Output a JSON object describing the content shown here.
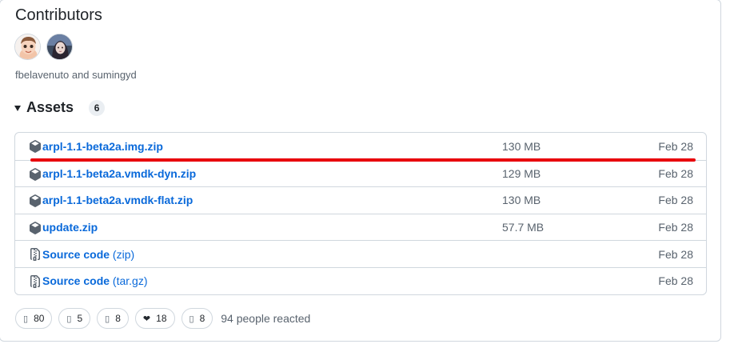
{
  "contributors": {
    "title": "Contributors",
    "names": "fbelavenuto and sumingyd",
    "avatars": [
      {
        "name": "fbelavenuto"
      },
      {
        "name": "sumingyd"
      }
    ]
  },
  "assets": {
    "title": "Assets",
    "count": "6",
    "items": [
      {
        "icon": "package-icon",
        "name": "arpl-1.1-beta2a.img.zip",
        "size": "130 MB",
        "date": "Feb 28"
      },
      {
        "icon": "package-icon",
        "name": "arpl-1.1-beta2a.vmdk-dyn.zip",
        "size": "129 MB",
        "date": "Feb 28"
      },
      {
        "icon": "package-icon",
        "name": "arpl-1.1-beta2a.vmdk-flat.zip",
        "size": "130 MB",
        "date": "Feb 28"
      },
      {
        "icon": "package-icon",
        "name": "update.zip",
        "size": "57.7 MB",
        "date": "Feb 28"
      },
      {
        "icon": "file-zip-icon",
        "name": "Source code",
        "ext": "(zip)",
        "size": "",
        "date": "Feb 28"
      },
      {
        "icon": "file-zip-icon",
        "name": "Source code",
        "ext": "(tar.gz)",
        "size": "",
        "date": "Feb 28"
      }
    ]
  },
  "reactions": {
    "items": [
      {
        "icon": "emoji-placeholder-icon",
        "glyph": "▯",
        "count": "80"
      },
      {
        "icon": "emoji-placeholder-icon",
        "glyph": "▯",
        "count": "5"
      },
      {
        "icon": "emoji-placeholder-icon",
        "glyph": "▯",
        "count": "8"
      },
      {
        "icon": "heart-icon",
        "glyph": "❤",
        "count": "18"
      },
      {
        "icon": "emoji-placeholder-icon",
        "glyph": "▯",
        "count": "8"
      }
    ],
    "summary": "94 people reacted"
  },
  "colors": {
    "link": "#0969da",
    "muted": "#59636e",
    "border": "#d0d7de",
    "highlight": "#e8000b"
  }
}
